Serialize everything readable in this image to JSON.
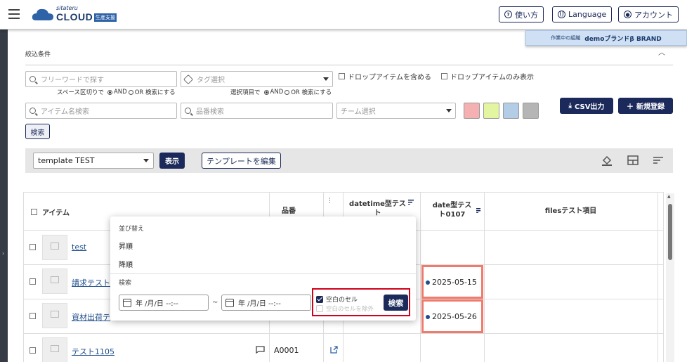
{
  "header": {
    "logo_small": "sitateru",
    "logo_main": "CLOUD",
    "logo_badge": "生産支援",
    "help_label": "使い方",
    "language_label": "Language",
    "account_label": "アカウント"
  },
  "org_banner": {
    "label": "作業中の組織",
    "value": "demoブランドβ BRAND"
  },
  "filters": {
    "title": "絞込条件",
    "freeword_placeholder": "フリーワードで探す",
    "freeword_hint_pre": "スペース区切りで",
    "freeword_hint_and": "AND",
    "freeword_hint_or": "OR 検索にする",
    "tag_placeholder": "タグ選択",
    "tag_hint_pre": "選択項目で",
    "tag_hint_and": "AND",
    "tag_hint_or": "OR 検索にする",
    "include_drop_label": "ドロップアイテムを含める",
    "drop_only_label": "ドロップアイテムのみ表示",
    "item_name_placeholder": "アイテム名検索",
    "part_no_placeholder": "品番検索",
    "team_placeholder": "チーム選択",
    "swatch_colors": [
      "#f5b1b1",
      "#e3f5a0",
      "#b3cde6",
      "#b5b5b5"
    ],
    "search_label": "検索",
    "csv_label": "CSV出力",
    "new_label": "新規登録"
  },
  "template_bar": {
    "selected": "template TEST",
    "show_label": "表示",
    "edit_label": "テンプレートを編集"
  },
  "table": {
    "headers": {
      "item": "アイテム",
      "part_no": "品番",
      "datetime": "datetime型テスト",
      "date": "date型テスト0107",
      "files": "filesテスト項目"
    },
    "rows": [
      {
        "name": "test",
        "part_no": "",
        "date": ""
      },
      {
        "name": "請求テスト",
        "part_no": "",
        "date": "2025-05-15"
      },
      {
        "name": "資材出荷テ",
        "part_no": "",
        "date": "2025-05-26"
      },
      {
        "name": "テスト1105",
        "part_no": "A0001",
        "date": ""
      }
    ]
  },
  "popup": {
    "sort_section": "並び替え",
    "asc_label": "昇順",
    "desc_label": "降順",
    "search_section": "検索",
    "date_from": "年 /月/日 --:--",
    "date_sep": "~",
    "date_to": "年 /月/日 --:--",
    "blank_cell_label": "空白のセル",
    "exclude_blank_label": "空白のセルを除外",
    "search_label": "検索"
  }
}
